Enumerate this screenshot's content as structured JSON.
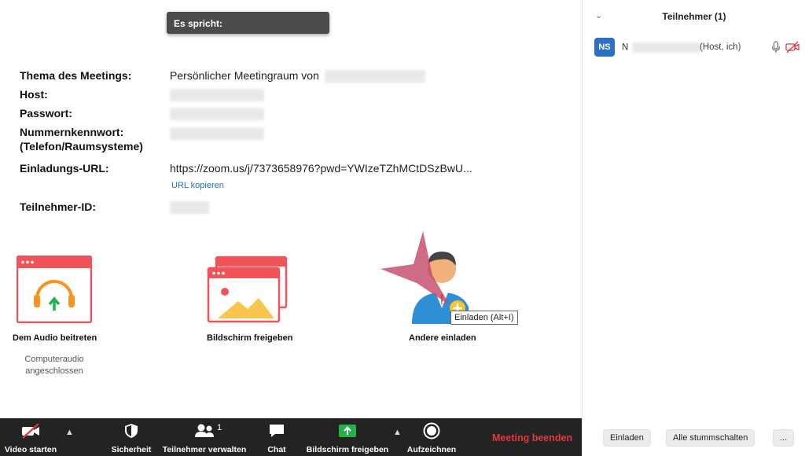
{
  "speaker": {
    "label": "Es spricht:"
  },
  "meeting_info": {
    "topic_label": "Thema des Meetings:",
    "topic_value": "Persönlicher Meetingraum von",
    "host_label": "Host:",
    "password_label": "Passwort:",
    "numeric_pw_label_line1": "Nummernkennwort:",
    "numeric_pw_label_line2": "(Telefon/Raumsysteme)",
    "invite_url_label": "Einladungs-URL:",
    "invite_url_value": "https://zoom.us/j/7373658976?pwd=YWIzeTZhMCtDSzBwU...",
    "copy_url_label": "URL kopieren",
    "participant_id_label": "Teilnehmer-ID:"
  },
  "actions": {
    "join_audio": {
      "label": "Dem Audio beitreten",
      "sub_line1": "Computeraudio",
      "sub_line2": "angeschlossen"
    },
    "share_screen": {
      "label": "Bildschirm freigeben"
    },
    "invite_others": {
      "label": "Andere einladen"
    }
  },
  "tooltip": {
    "text": "Einladen (Alt+I)"
  },
  "toolbar": {
    "video": "Video starten",
    "security": "Sicherheit",
    "participants": "Teilnehmer verwalten",
    "participants_count": "1",
    "chat": "Chat",
    "share": "Bildschirm freigeben",
    "record": "Aufzeichnen",
    "end": "Meeting beenden"
  },
  "panel": {
    "title": "Teilnehmer (1)",
    "participant": {
      "initials": "NS",
      "name_first_char": "N",
      "role": "(Host, ich)"
    },
    "buttons": {
      "invite": "Einladen",
      "mute_all": "Alle stummschalten",
      "more": "..."
    }
  },
  "colors": {
    "accent_red": "#e5383b",
    "link_blue": "#1f6fd1",
    "avatar_blue": "#2d6fc0",
    "share_green": "#24b14a",
    "toolbar_bg": "#232323",
    "tile_red": "#f0535a",
    "headphone_orange": "#f7931e"
  }
}
